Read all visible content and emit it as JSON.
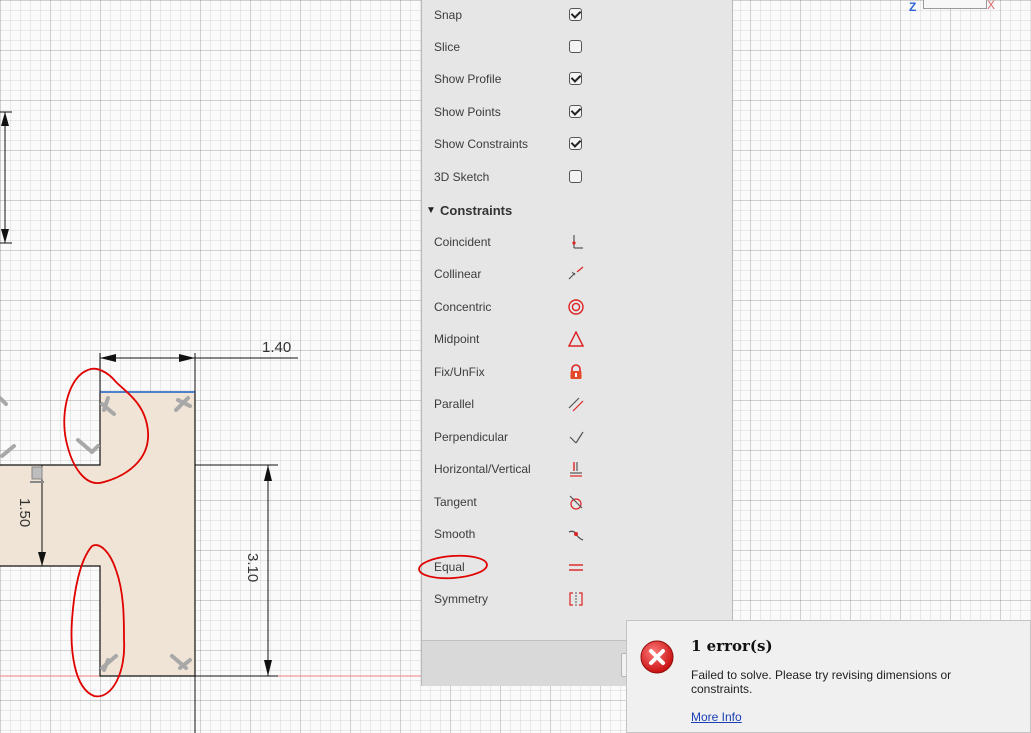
{
  "canvas": {
    "dimensions": [
      {
        "name": "width-dimension",
        "text": "1.40"
      },
      {
        "name": "height-dimension-right",
        "text": "3.10"
      },
      {
        "name": "height-dimension-left",
        "text": "1.50"
      }
    ]
  },
  "palette": {
    "options": [
      {
        "label": "Snap",
        "checked": true
      },
      {
        "label": "Slice",
        "checked": false
      },
      {
        "label": "Show Profile",
        "checked": true
      },
      {
        "label": "Show Points",
        "checked": true
      },
      {
        "label": "Show Constraints",
        "checked": true
      },
      {
        "label": "3D Sketch",
        "checked": false
      }
    ],
    "constraints_header": "Constraints",
    "constraints": [
      {
        "label": "Coincident",
        "icon": "coincident-icon"
      },
      {
        "label": "Collinear",
        "icon": "collinear-icon"
      },
      {
        "label": "Concentric",
        "icon": "concentric-icon"
      },
      {
        "label": "Midpoint",
        "icon": "midpoint-icon"
      },
      {
        "label": "Fix/UnFix",
        "icon": "lock-icon"
      },
      {
        "label": "Parallel",
        "icon": "parallel-icon"
      },
      {
        "label": "Perpendicular",
        "icon": "perpendicular-icon"
      },
      {
        "label": "Horizontal/Vertical",
        "icon": "horizontal-vertical-icon"
      },
      {
        "label": "Tangent",
        "icon": "tangent-icon"
      },
      {
        "label": "Smooth",
        "icon": "smooth-icon"
      },
      {
        "label": "Equal",
        "icon": "equal-icon"
      },
      {
        "label": "Symmetry",
        "icon": "symmetry-icon"
      }
    ]
  },
  "error": {
    "title": "1 error(s)",
    "message": "Failed to solve. Please try revising dimensions or constraints.",
    "link": "More Info"
  },
  "viewcube": {
    "z_label": "Z",
    "x_label": "X"
  },
  "colors": {
    "profile_fill": "#efe4d6",
    "annotation_red": "#e00000",
    "error_red": "#d11f1f",
    "link_blue": "#1a3fb3"
  }
}
